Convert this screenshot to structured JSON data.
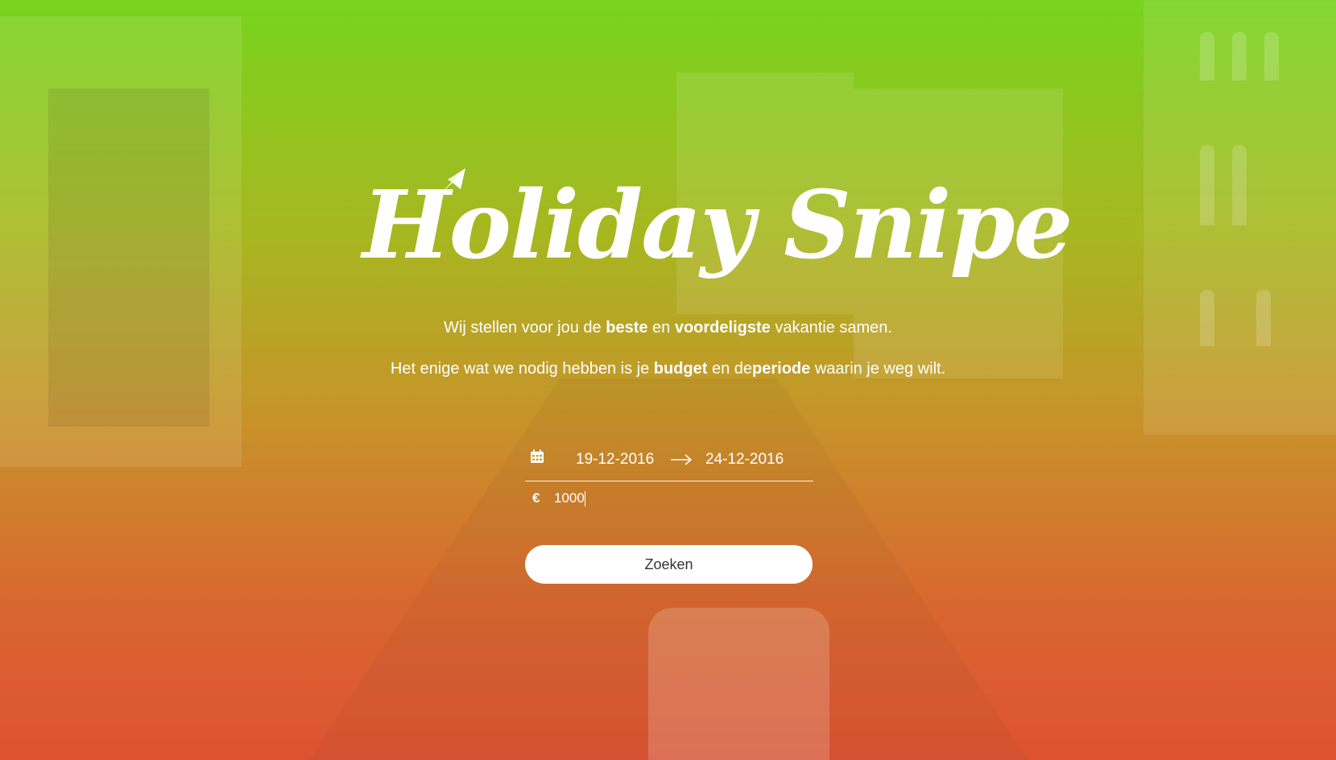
{
  "brand": {
    "logo_text": "Holiday Snipe"
  },
  "intro": {
    "line1": {
      "part1": "Wij stellen voor jou de ",
      "bold1": "beste",
      "part2": " en ",
      "bold2": "voordeligste",
      "part3": " vakantie samen."
    },
    "line2": {
      "part1": "Het enige wat we nodig hebben is je ",
      "bold1": "budget",
      "part2": " en de",
      "bold2": "periode",
      "part3": " waarin je weg wilt."
    }
  },
  "search_form": {
    "date_from": "19-12-2016",
    "date_to": "24-12-2016",
    "currency_symbol": "€",
    "budget_value": "1000",
    "submit_label": "Zoeken"
  },
  "icons": {
    "calendar": "calendar-icon",
    "arrow": "arrow-right-icon",
    "plane": "paper-plane-icon"
  },
  "colors": {
    "gradient_top": "#78d41e",
    "gradient_bottom": "#de5232",
    "text": "#ffffff",
    "button_bg": "#ffffff",
    "button_text": "#333333"
  }
}
